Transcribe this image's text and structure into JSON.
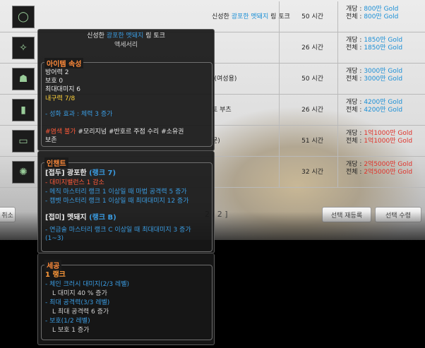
{
  "auction": {
    "rows": [
      {
        "icon": "ring-icon",
        "glyph": "◯",
        "name_prefix": "신성한 ",
        "name_blue": "광포한 멧돼지",
        "name_suffix": " 링 토크",
        "time": "50 시간",
        "per_label": "개당 : ",
        "per_value": "800만 Gold",
        "total_label": "전체 : ",
        "total_value": "800만 Gold",
        "price_color": "blue"
      },
      {
        "icon": "wings-icon",
        "glyph": "✧",
        "name_prefix": "",
        "name_blue": "",
        "name_suffix": "",
        "time": "26 시간",
        "per_label": "개당 : ",
        "per_value": "1850만 Gold",
        "total_label": "전체 : ",
        "total_value": "1850만 Gold",
        "price_color": "blue"
      },
      {
        "icon": "figure-icon",
        "glyph": "☗",
        "name_prefix": "",
        "name_blue": "",
        "name_suffix": ")(여성용)",
        "time": "50 시간",
        "per_label": "개당 : ",
        "per_value": "3000만 Gold",
        "total_label": "전체 : ",
        "total_value": "3000만 Gold",
        "price_color": "blue"
      },
      {
        "icon": "boots-icon",
        "glyph": "▮",
        "name_prefix": "",
        "name_blue": "",
        "name_suffix": "토 부츠",
        "time": "26 시간",
        "per_label": "개당 : ",
        "per_value": "4200만 Gold",
        "total_label": "전체 : ",
        "total_value": "4200만 Gold",
        "price_color": "blue"
      },
      {
        "icon": "scroll-icon",
        "glyph": "▭",
        "name_prefix": "",
        "name_blue": "",
        "name_suffix": "문)",
        "time": "51 시간",
        "per_label": "개당 : ",
        "per_value": "1억1000만 Gold",
        "total_label": "전체 : ",
        "total_value": "1억1000만 Gold",
        "price_color": "red"
      },
      {
        "icon": "gem-icon",
        "glyph": "✺",
        "name_prefix": "",
        "name_blue": "",
        "name_suffix": "",
        "time": "32 시간",
        "per_label": "개당 : ",
        "per_value": "2억5000만 Gold",
        "total_label": "전체 : ",
        "total_value": "2억5000만 Gold",
        "price_color": "red"
      }
    ],
    "cancel_button": "취소",
    "page": "2 / 2 ]",
    "register_button": "선택 재등록",
    "collect_button": "선택 수령"
  },
  "tooltip": {
    "title_prefix": "신성한 ",
    "title_blue": "광포한 멧돼지",
    "title_suffix": " 링 토크",
    "subtitle": "액세서리",
    "attr_header": "아이템 속성",
    "defense": "방어력 2",
    "protection": "보호 0",
    "max_damage": "최대대미지 6",
    "durability": "내구력 7/8",
    "refine_effect": "- 성화 효과 : 체력 3 증가",
    "restrictions": [
      "#염색 불가",
      "#모리지넘",
      "#반호르 주점 수리",
      "#소유권"
    ],
    "restriction_cont": "보존",
    "enchant_header": "인챈트",
    "prefix_label": "[접두] 광포한",
    "prefix_rank": "(랭크 7)",
    "prefix_lines": [
      "- 대미지밸런스 1 감소",
      "- 메직 마스터리 랭크 1 이상일 때 마법 공격력 5 증가",
      "- 캠벳 마스터리 랭크 1 이상일 때 최대대미지 12 증가"
    ],
    "suffix_label": "[접미] 멧돼지",
    "suffix_rank": "(랭크 B)",
    "suffix_lines": [
      "- 연금술 마스터리 랭크 C 이상일 때 최대대미지 3 증가",
      "(1~3)"
    ],
    "craft_header": "세공",
    "craft_rank": "1 랭크",
    "craft_lines": [
      {
        "text": "- 체인 크러시 대미지(2/3 레벨)",
        "cls": "blue"
      },
      {
        "text": "L 대미지 40 % 증가",
        "cls": "dim"
      },
      {
        "text": "- 최대 공격력(3/3 레벨)",
        "cls": "blue"
      },
      {
        "text": "L 최대 공격력 6 증가",
        "cls": "dim"
      },
      {
        "text": "- 보호(1/2 레벨)",
        "cls": "blue"
      },
      {
        "text": "L 보호 1 증가",
        "cls": "dim"
      }
    ]
  }
}
